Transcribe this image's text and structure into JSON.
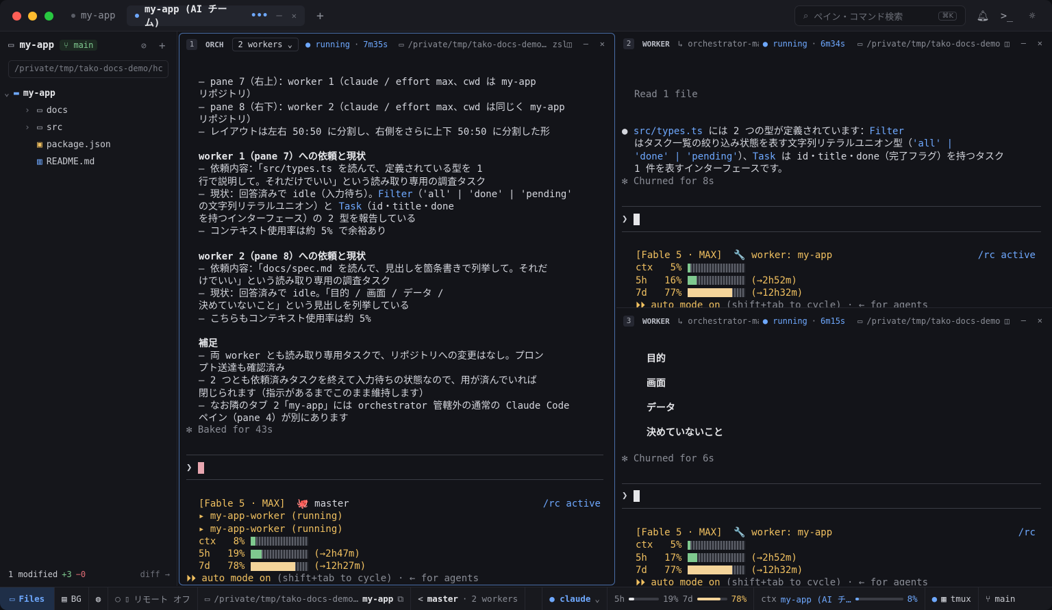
{
  "titlebar": {
    "tabs": [
      {
        "label": "my-app"
      },
      {
        "label": "my-app (AI チーム)",
        "more": "•••",
        "min": "—",
        "close": "✕"
      }
    ],
    "new_tab": "+",
    "search_placeholder": "ペイン・コマンド検索",
    "search_kbd": "⌘K"
  },
  "sidebar": {
    "repo": "my-app",
    "branch": "main",
    "path": "/private/tmp/tako-docs-demo/hc",
    "tree": [
      {
        "label": "my-app",
        "type": "folder-open"
      },
      {
        "label": "docs",
        "type": "folder"
      },
      {
        "label": "src",
        "type": "folder"
      },
      {
        "label": "package.json",
        "type": "package"
      },
      {
        "label": "README.md",
        "type": "book"
      }
    ],
    "footer": {
      "modified": "1 modified",
      "add": "+3",
      "del": "−0",
      "diff": "diff →"
    }
  },
  "pane1": {
    "num": "1",
    "role": "ORCH",
    "workers": "2 workers",
    "state": "running",
    "time": "7m35s",
    "path": "/private/tmp/tako-docs-demo…",
    "extra": "zsl",
    "lines": [
      "– pane 7（右上）：worker 1（claude / effort max、cwd は my-app",
      "リポジトリ）",
      "– pane 8（右下）：worker 2（claude / effort max、cwd は同じく my-app",
      "リポジトリ）",
      "– レイアウトは左右 50:50 に分割し、右側をさらに上下 50:50 に分割した形"
    ],
    "w1_title": "worker 1（pane 7）への依頼と現状",
    "w1_lines": [
      "– 依頼内容：「src/types.ts を読んで、定義されている型を 1",
      "行で説明して。それだけでいい」という読み取り専用の調査タスク"
    ],
    "w1_status_a": "– 現状：回答済みで idle（入力待ち）。",
    "w1_filter": "Filter",
    "w1_status_b": "（'all' | 'done' | 'pending'",
    "w1_line3a": "の文字列リテラルユニオン）と ",
    "w1_task": "Task",
    "w1_line3b": "（id・title・done",
    "w1_line4": "を持つインターフェース）の 2 型を報告している",
    "w1_line5": "– コンテキスト使用率は約 5% で余裕あり",
    "w2_title": "worker 2（pane 8）への依頼と現状",
    "w2_lines": [
      "– 依頼内容：「docs/spec.md を読んで、見出しを箇条書きで列挙して。それだ",
      "けでいい」という読み取り専用の調査タスク",
      "– 現状：回答済みで idle。「目的 / 画面 / データ /",
      "決めていないこと」という見出しを列挙している",
      "– こちらもコンテキスト使用率は約 5%"
    ],
    "note_title": "補足",
    "note_lines": [
      "– 両 worker とも読み取り専用タスクで、リポジトリへの変更はなし。プロン",
      "プト送達も確認済み",
      "– 2 つとも依頼済みタスクを終えて入力待ちの状態なので、用が済んでいれば",
      "閉じられます（指示があるまでこのまま維持します）",
      "– なお隣のタブ 2「my-app」には orchestrator 管轄外の通常の Claude Code",
      "ペイン（pane 4）が別にあります"
    ],
    "baked": "✻ Baked for 43s",
    "prompt": "❯",
    "footer": {
      "model": "[Fable 5 · MAX]",
      "agent": "🐙 master",
      "rc": "/rc active",
      "workers": [
        "▸ my-app-worker (running)",
        "▸ my-app-worker (running)"
      ],
      "ctx": {
        "label": "ctx",
        "pct": "8%",
        "value": 0.08
      },
      "h5": {
        "label": "5h",
        "pct": "19%",
        "value": 0.19,
        "reset": "(→2h47m)"
      },
      "d7": {
        "label": "7d",
        "pct": "78%",
        "value": 0.78,
        "reset": "(→12h27m)"
      },
      "auto_a": "⏵⏵ auto mode on",
      "auto_b": " (shift+tab to cycle) · ← for agents"
    }
  },
  "pane2": {
    "num": "2",
    "role": "WORKER",
    "parent": "↳ orchestrator-ma…",
    "state": "running",
    "time": "6m34s",
    "path": "/private/tmp/tako-docs-demo",
    "read": "Read 1 file",
    "answer_file": "src/types.ts",
    "answer_a": " には 2 つの型が定義されています：",
    "answer_filter": "Filter",
    "answer_l2a": "はタスク一覧の絞り込み状態を表す文字列リテラルユニオン型（",
    "answer_l2b": "'all' |",
    "answer_l3a": "'done' | 'pending'",
    "answer_l3b": "）、",
    "answer_task": "Task",
    "answer_l3c": " は id・title・done（完了フラグ）を持つタスク",
    "answer_l4": "1 件を表すインターフェースです。",
    "churn": "✻ Churned for 8s",
    "prompt": "❯",
    "footer": {
      "model": "[Fable 5 · MAX]",
      "agent": "🔧 worker: my-app",
      "rc": "/rc active",
      "ctx": {
        "label": "ctx",
        "pct": "5%",
        "value": 0.05
      },
      "h5": {
        "label": "5h",
        "pct": "16%",
        "value": 0.16,
        "reset": "(→2h52m)"
      },
      "d7": {
        "label": "7d",
        "pct": "77%",
        "value": 0.77,
        "reset": "(→12h32m)"
      },
      "auto_a": "⏵⏵ auto mode on",
      "auto_b": " (shift+tab to cycle) · ← for agents"
    }
  },
  "pane3": {
    "num": "3",
    "role": "WORKER",
    "parent": "↳ orchestrator-ma…",
    "state": "running",
    "time": "6m15s",
    "path": "/private/tmp/tako-docs-demo",
    "headings": [
      "目的",
      "画面",
      "データ",
      "決めていないこと"
    ],
    "churn": "✻ Churned for 6s",
    "prompt": "❯",
    "footer": {
      "model": "[Fable 5 · MAX]",
      "agent": "🔧 worker: my-app",
      "rc": "/rc",
      "ctx": {
        "label": "ctx",
        "pct": "5%",
        "value": 0.05
      },
      "h5": {
        "label": "5h",
        "pct": "17%",
        "value": 0.17,
        "reset": "(→2h52m)"
      },
      "d7": {
        "label": "7d",
        "pct": "77%",
        "value": 0.77,
        "reset": "(→12h32m)"
      },
      "auto_a": "⏵⏵ auto mode on",
      "auto_b": " (shift+tab to cycle) · ← for agents"
    }
  },
  "statusbar": {
    "files": "Files",
    "bg": "BG",
    "remote": "リモート オフ",
    "path": "/private/tmp/tako-docs-demo…",
    "app": "my-app",
    "branch": "master",
    "workers": "2 workers",
    "agent": "claude",
    "h5_label": "5h",
    "h5_pct": "19%",
    "h5_value": 0.19,
    "d7_label": "7d",
    "d7_pct": "78%",
    "d7_value": 0.78,
    "ctx_label": "ctx",
    "ctx_name": "my-app (AI チ…",
    "ctx_pct": "8%",
    "ctx_value": 0.08,
    "tmux": "tmux",
    "git": "main"
  },
  "colors": {
    "accent": "#6ea8fe",
    "yellow": "#f0c060",
    "green": "#7fc98f",
    "bar_fill": "#f4d49a"
  }
}
